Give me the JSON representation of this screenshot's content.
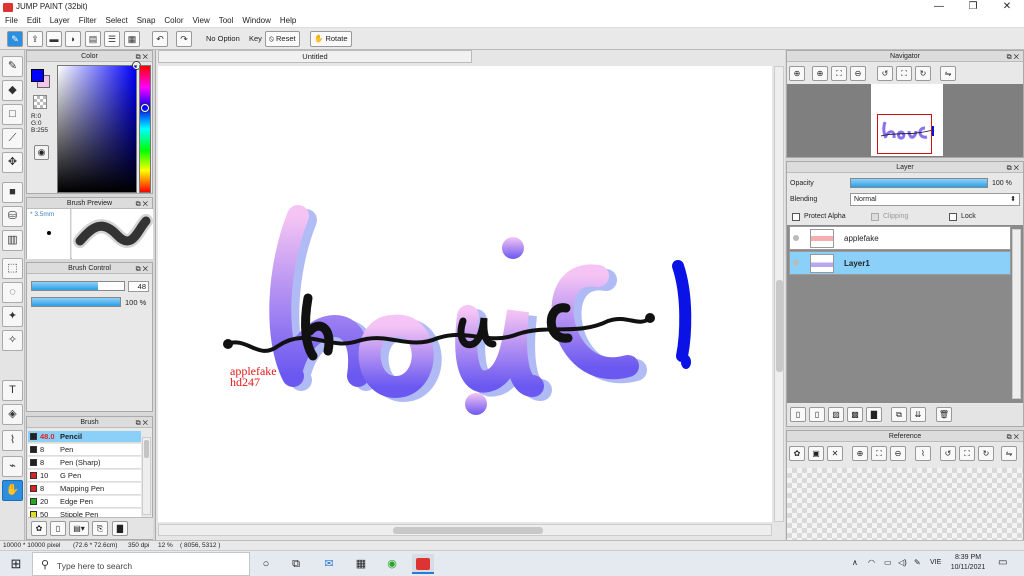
{
  "app": {
    "title": "JUMP PAINT (32bit)"
  },
  "menu": [
    "File",
    "Edit",
    "Layer",
    "Filter",
    "Select",
    "Snap",
    "Color",
    "View",
    "Tool",
    "Window",
    "Help"
  ],
  "toolbar": {
    "no_option": "No Option",
    "key": "Key",
    "reset": "Reset",
    "rotate": "Rotate"
  },
  "color_panel": {
    "title": "Color",
    "r": "R:0",
    "g": "G:0",
    "b": "B:255",
    "foreground": "#0000ff",
    "background": "#f3c6ea"
  },
  "brush_preview": {
    "title": "Brush Preview",
    "size": "* 3.5mm"
  },
  "brush_control": {
    "title": "Brush Control",
    "size_value": "48",
    "size_fraction": 0.72,
    "opacity_value": "100 %",
    "opacity_fraction": 1.0
  },
  "brush_list": {
    "title": "Brush",
    "items": [
      {
        "num": "48.0",
        "name": "Pencil",
        "color": "#222222",
        "selected": true
      },
      {
        "num": "8",
        "name": "Pen",
        "color": "#222222"
      },
      {
        "num": "8",
        "name": "Pen (Sharp)",
        "color": "#222222"
      },
      {
        "num": "10",
        "name": "G Pen",
        "color": "#dd2222"
      },
      {
        "num": "8",
        "name": "Mapping Pen",
        "color": "#dd2222"
      },
      {
        "num": "20",
        "name": "Edge Pen",
        "color": "#22aa22"
      },
      {
        "num": "50",
        "name": "Stipple Pen",
        "color": "#dddd22"
      }
    ]
  },
  "document": {
    "tab_title": "Untitled",
    "watermark_line1": "applefake",
    "watermark_line2": "hd247"
  },
  "navigator": {
    "title": "Navigator"
  },
  "layer_panel": {
    "title": "Layer",
    "opacity_label": "Opacity",
    "opacity_value": "100 %",
    "opacity_fraction": 1.0,
    "blending_label": "Blending",
    "blending_value": "Normal",
    "protect_alpha": "Protect Alpha",
    "clipping": "Clipping",
    "lock": "Lock",
    "layers": [
      {
        "name": "applefake",
        "selected": false
      },
      {
        "name": "Layer1",
        "selected": true
      }
    ]
  },
  "reference": {
    "title": "Reference"
  },
  "status": {
    "dimensions": "10000 * 10000 pixel",
    "physical": "(72.6 * 72.6cm)",
    "dpi": "350 dpi",
    "zoom": "12 %",
    "coords": "( 8056, 5312 )"
  },
  "taskbar": {
    "search_placeholder": "Type here to search",
    "time": "8:39 PM",
    "date": "10/11/2021",
    "lang": "VIE"
  },
  "colors": {
    "accent": "#2aa0e6",
    "selection": "#8ad0f8"
  }
}
